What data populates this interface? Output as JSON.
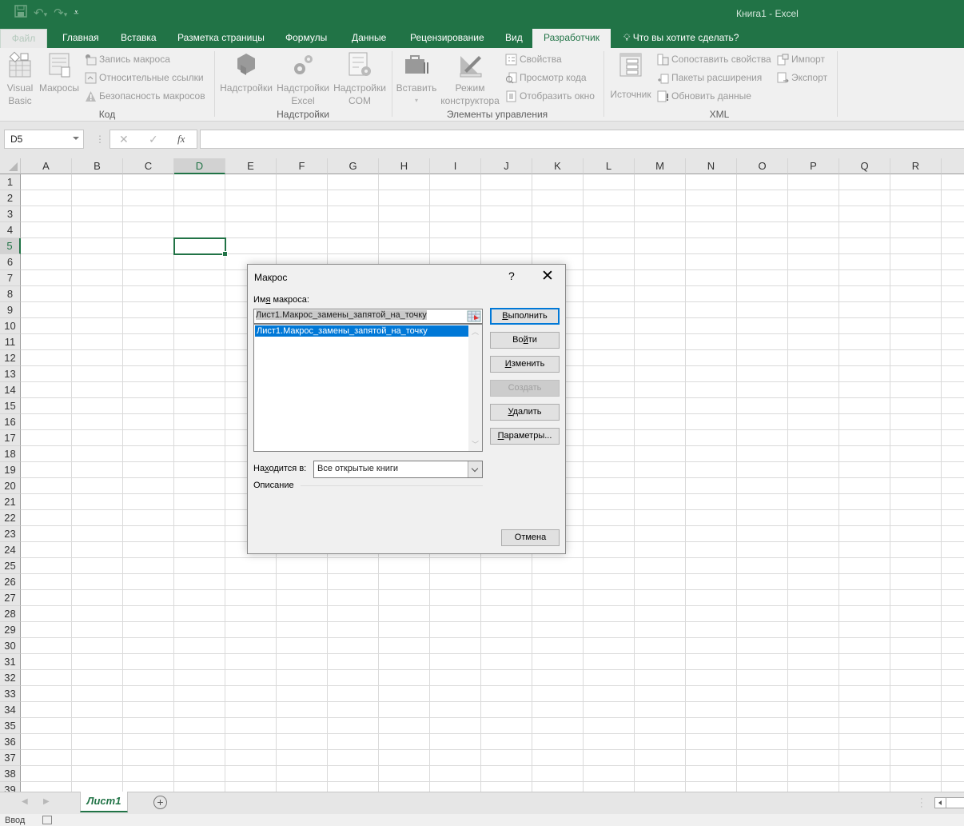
{
  "window": {
    "title": "Книга1 - Excel",
    "accent_color": "#217346"
  },
  "quick_access": {
    "save_icon": "save-icon",
    "undo_icon": "undo-icon",
    "redo_icon": "redo-icon",
    "customize_icon": "customize-qat-icon"
  },
  "tabs": [
    {
      "label": "Файл"
    },
    {
      "label": "Главная"
    },
    {
      "label": "Вставка"
    },
    {
      "label": "Разметка страницы"
    },
    {
      "label": "Формулы"
    },
    {
      "label": "Данные"
    },
    {
      "label": "Рецензирование"
    },
    {
      "label": "Вид"
    },
    {
      "label": "Разработчик",
      "active": true
    }
  ],
  "tell_me": "Что вы хотите сделать?",
  "ribbon": {
    "code": {
      "label": "Код",
      "visual_basic": [
        "Visual",
        "Basic"
      ],
      "macros": "Макросы",
      "record_macro": "Запись макроса",
      "relative_refs": "Относительные ссылки",
      "macro_security": "Безопасность макросов"
    },
    "addins": {
      "label": "Надстройки",
      "addins": "Надстройки",
      "excel_addins": [
        "Надстройки",
        "Excel"
      ],
      "com_addins": [
        "Надстройки",
        "COM"
      ]
    },
    "controls": {
      "label": "Элементы управления",
      "insert": "Вставить",
      "design_mode": [
        "Режим",
        "конструктора"
      ],
      "properties": "Свойства",
      "view_code": "Просмотр кода",
      "run_dialog": "Отобразить окно"
    },
    "xml": {
      "label": "XML",
      "source": "Источник",
      "map_properties": "Сопоставить свойства",
      "expansion_packs": "Пакеты расширения",
      "refresh_data": "Обновить данные",
      "import": "Импорт",
      "export": "Экспорт"
    }
  },
  "formula_bar": {
    "name_box": "D5",
    "cancel_icon": "✕",
    "enter_icon": "✓",
    "fx_label": "fx",
    "value": ""
  },
  "grid": {
    "columns": [
      "A",
      "B",
      "C",
      "D",
      "E",
      "F",
      "G",
      "H",
      "I",
      "J",
      "K",
      "L",
      "M",
      "N",
      "O",
      "P",
      "Q",
      "R"
    ],
    "rows": [
      "1",
      "2",
      "3",
      "4",
      "5",
      "6",
      "7",
      "8",
      "9",
      "10",
      "11",
      "12",
      "13",
      "14",
      "15",
      "16",
      "17",
      "18",
      "19",
      "20",
      "21",
      "22",
      "23",
      "24",
      "25",
      "26",
      "27",
      "28",
      "29",
      "30",
      "31",
      "32",
      "33",
      "34",
      "35",
      "36",
      "37",
      "38",
      "39"
    ],
    "selected_cell": "D5",
    "selected_column": "D",
    "selected_row": "5"
  },
  "sheets": {
    "tabs": [
      "Лист1"
    ],
    "active": "Лист1",
    "add_label": "+"
  },
  "status": {
    "mode": "Ввод"
  },
  "dialog": {
    "title": "Макрос",
    "help": "?",
    "close": "✕",
    "macro_name_label_pre": "Им",
    "macro_name_label_u": "я",
    "macro_name_label_post": " макроса:",
    "macro_name_value": "Лист1.Макрос_замены_запятой_на_точку",
    "macro_list": [
      "Лист1.Макрос_замены_запятой_на_точку"
    ],
    "selected_macro": "Лист1.Макрос_замены_запятой_на_точку",
    "buttons": {
      "run": {
        "u": "В",
        "rest": "ыполнить"
      },
      "step_into": {
        "pre": "Во",
        "u": "й",
        "rest": "ти"
      },
      "edit": {
        "u": "И",
        "rest": "зменить"
      },
      "create": "Создать",
      "delete": {
        "u": "У",
        "rest": "далить"
      },
      "options": {
        "u": "П",
        "rest": "араметры..."
      },
      "cancel": "Отмена"
    },
    "location_label_pre": "На",
    "location_label_u": "х",
    "location_label_post": "одится в:",
    "location_value": "Все открытые книги",
    "description_label": "Описание",
    "description_value": ""
  }
}
